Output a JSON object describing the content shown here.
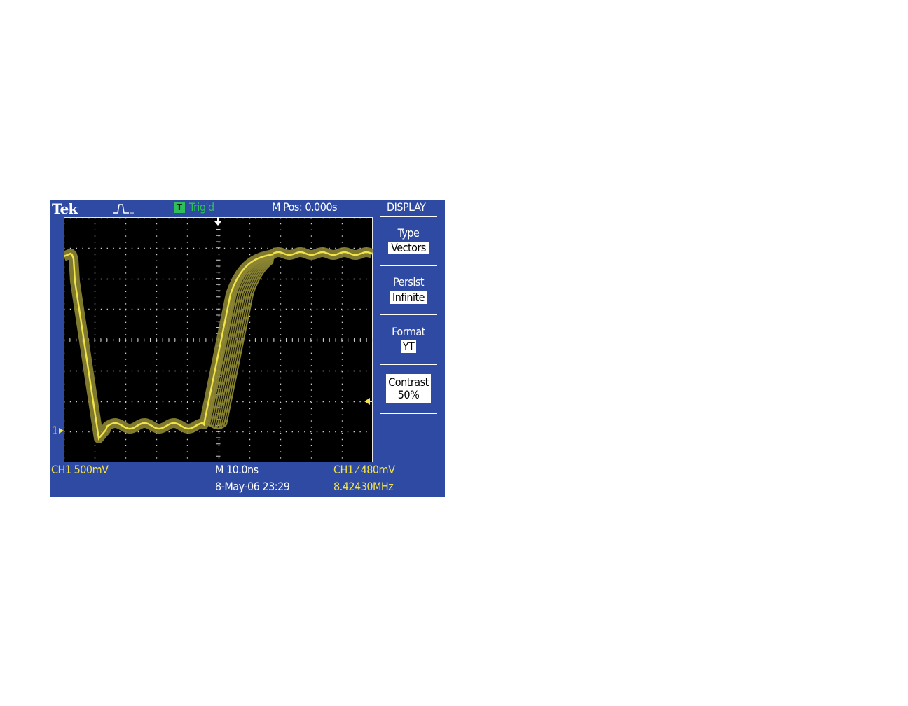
{
  "brand": "Tek",
  "status": {
    "trigger_badge": "T",
    "trigger_state": "Trig'd",
    "position": "M Pos: 0.000s"
  },
  "menu": {
    "title": "DISPLAY",
    "items": [
      {
        "label": "Type",
        "value": "Vectors"
      },
      {
        "label": "Persist",
        "value": "Infinite"
      },
      {
        "label": "Format",
        "value": "YT"
      },
      {
        "label": "Contrast",
        "value": "50%"
      }
    ]
  },
  "readouts": {
    "channel": "CH1  500mV",
    "timebase": "M 10.0ns",
    "date": "8-May-06 23:29",
    "trigger": "CH1 ⁄ 480mV",
    "frequency": "8.42430MHz",
    "ground_marker": "1"
  },
  "icons": [
    "acquisition-icon",
    "trigger-position-arrow-icon",
    "trigger-level-arrow-icon",
    "ground-marker-icon"
  ],
  "colors": {
    "frame": "#2f4aa3",
    "screen": "#000000",
    "trace": "#f2e34a",
    "persistence": "#8c8634",
    "trigger": "#2fbf5a"
  }
}
